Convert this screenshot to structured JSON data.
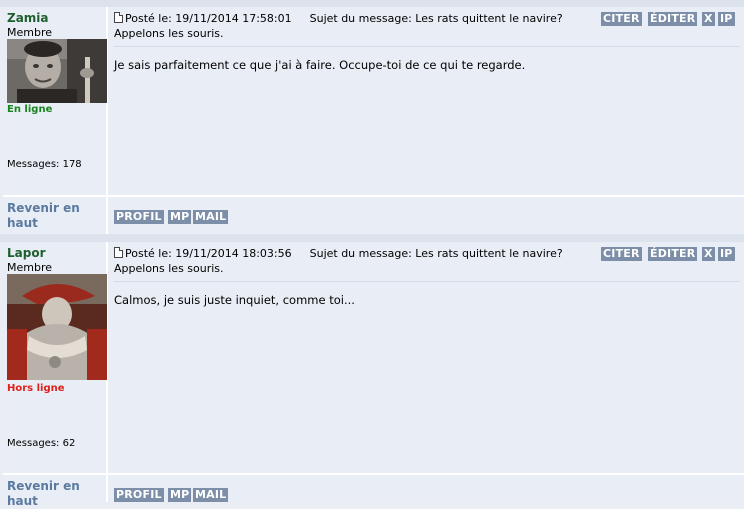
{
  "posts": [
    {
      "username": "Zamia",
      "rank": "Membre",
      "status": "En ligne",
      "status_color": "#17861c",
      "messages": "Messages: 178",
      "posted": "Posté le: 19/11/2014 17:58:01",
      "subject_line1": "Sujet du message: Les rats quittent le navire?",
      "subject_line2": "Appelons les souris.",
      "body": "Je sais parfaitement ce que j'ai à faire. Occupe-toi de ce qui te regarde.",
      "buttons": {
        "quote": "CITER",
        "edit": "ÉDITER",
        "delete": "X",
        "ip": "IP"
      },
      "footer_buttons": {
        "profile": "PROFIL",
        "pm": "MP",
        "mail": "MAIL"
      },
      "back_to_top": "Revenir en haut"
    },
    {
      "username": "Lapor",
      "rank": "Membre",
      "status": "Hors ligne",
      "status_color": "#e0201a",
      "messages": "Messages: 62",
      "posted": "Posté le: 19/11/2014 18:03:56",
      "subject_line1": "Sujet du message: Les rats quittent le navire?",
      "subject_line2": "Appelons les souris.",
      "body": "Calmos, je suis juste inquiet, comme toi...",
      "buttons": {
        "quote": "CITER",
        "edit": "ÉDITER",
        "delete": "X",
        "ip": "IP"
      },
      "footer_buttons": {
        "profile": "PROFIL",
        "pm": "MP",
        "mail": "MAIL"
      },
      "back_to_top": "Revenir en haut"
    }
  ]
}
